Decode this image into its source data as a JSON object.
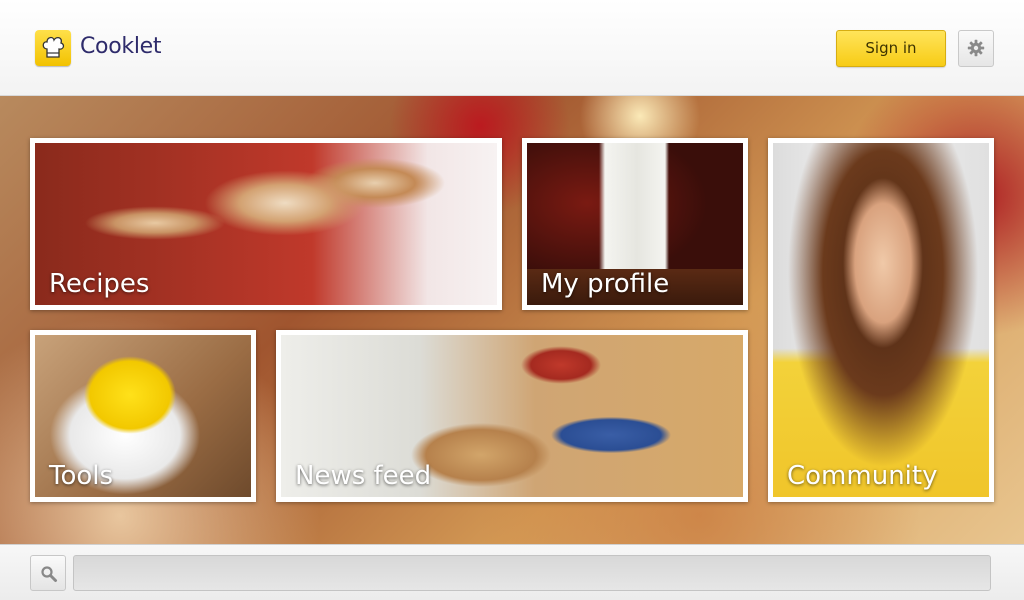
{
  "header": {
    "app_name": "Cooklet",
    "logo_icon": "chef-hat-icon",
    "signin_label": "Sign in",
    "settings_icon": "gear-icon"
  },
  "tiles": [
    {
      "label": "Recipes"
    },
    {
      "label": "My profile"
    },
    {
      "label": "Community"
    },
    {
      "label": "Tools"
    },
    {
      "label": "News feed"
    }
  ],
  "search": {
    "icon": "search-icon",
    "value": "",
    "placeholder": ""
  },
  "colors": {
    "accent": "#f7cc16",
    "logo_text": "#2e2b6b"
  }
}
